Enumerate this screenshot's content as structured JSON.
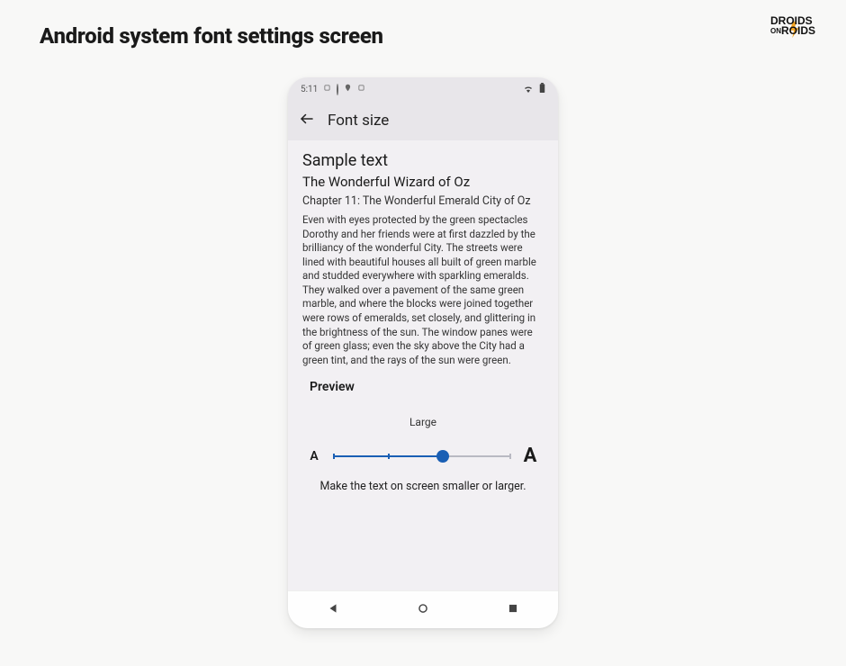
{
  "page": {
    "title": "Android system font settings screen"
  },
  "brand": {
    "line1": "DROIDS",
    "on": "ON",
    "line2": "ROIDS",
    "accent": "#f5a623"
  },
  "statusbar": {
    "time": "5:11",
    "icons_left": [
      "alarm-icon",
      "info-icon",
      "location-icon",
      "card-icon"
    ],
    "icons_right": [
      "wifi-icon",
      "battery-icon"
    ]
  },
  "appbar": {
    "title": "Font size"
  },
  "sample": {
    "heading": "Sample text",
    "title": "The Wonderful Wizard of Oz",
    "chapter": "Chapter 11: The Wonderful Emerald City of Oz",
    "body": "Even with eyes protected by the green spectacles Dorothy and her friends were at first dazzled by the brilliancy of the wonderful City. The streets were lined with beautiful houses all built of green marble and studded everywhere with sparkling emeralds. They walked over a pavement of the same green marble, and where the blocks were joined together were rows of emeralds, set closely, and glittering in the brightness of the sun. The window panes were of green glass; even the sky above the City had a green tint, and the rays of the sun were green."
  },
  "preview": {
    "label": "Preview",
    "size_label": "Large",
    "small_letter": "A",
    "large_letter": "A",
    "description": "Make the text on screen smaller or larger.",
    "slider": {
      "steps": 4,
      "value": 2,
      "fill_percent": 62,
      "accent": "#1a5fb4"
    }
  },
  "navbar": {
    "buttons": [
      "back",
      "home",
      "recent"
    ]
  }
}
